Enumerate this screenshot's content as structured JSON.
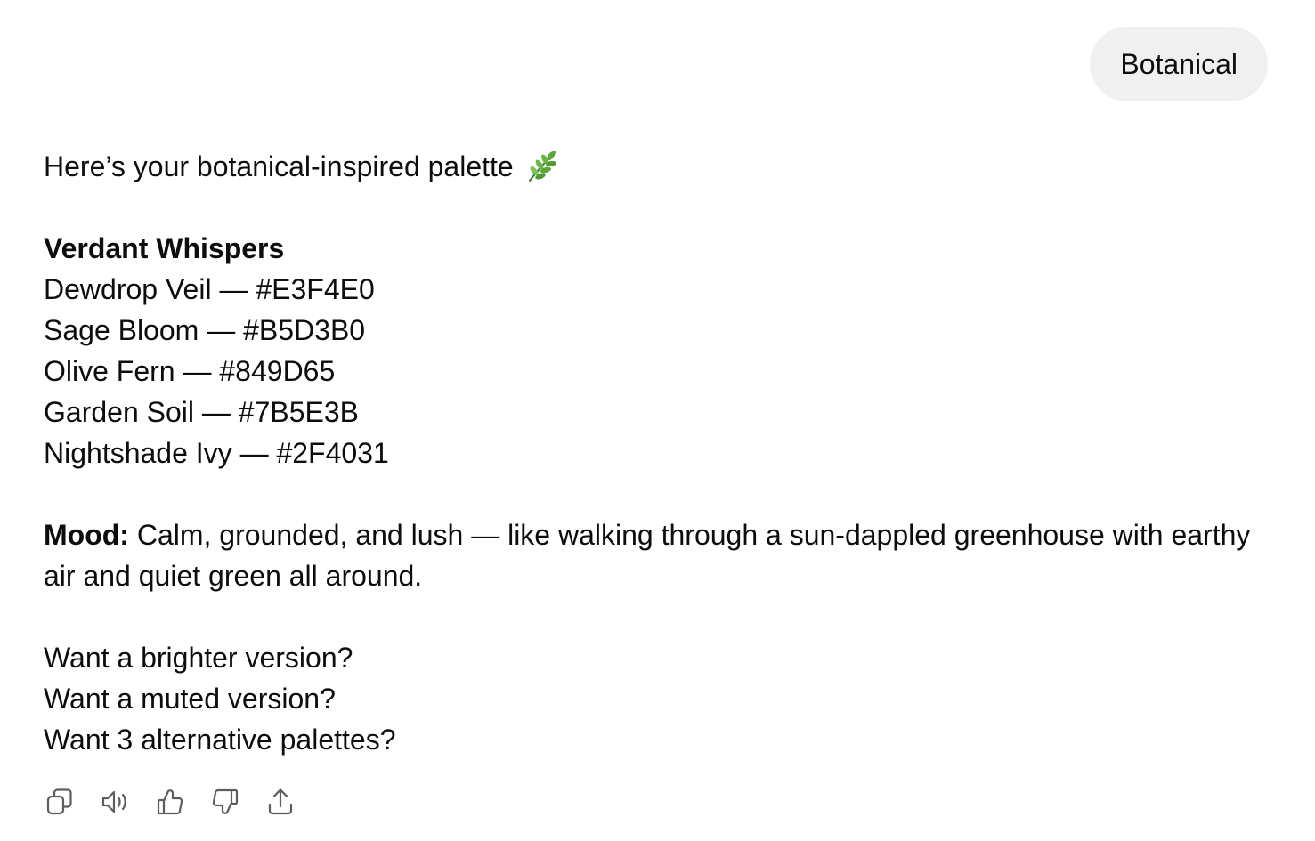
{
  "user_message": "Botanical",
  "assistant": {
    "intro": "Here’s your botanical-inspired palette",
    "intro_emoji": "herb-icon",
    "palette_name": "Verdant Whispers",
    "colors": [
      {
        "text": "Dewdrop Veil — #E3F4E0",
        "hex": "#E3F4E0"
      },
      {
        "text": "Sage Bloom — #B5D3B0",
        "hex": "#B5D3B0"
      },
      {
        "text": "Olive Fern — #849D65",
        "hex": "#849D65"
      },
      {
        "text": "Garden Soil — #7B5E3B",
        "hex": "#7B5E3B"
      },
      {
        "text": "Nightshade Ivy — #2F4031",
        "hex": "#2F4031"
      }
    ],
    "mood_label": "Mood:",
    "mood_text": " Calm, grounded, and lush — like walking through a sun-dappled greenhouse with earthy air and quiet green all around.",
    "followups": [
      "Want a brighter version?",
      "Want a muted version?",
      "Want 3 alternative palettes?"
    ]
  },
  "actions": [
    "copy-icon",
    "read-aloud-icon",
    "thumbs-up-icon",
    "thumbs-down-icon",
    "share-icon"
  ]
}
